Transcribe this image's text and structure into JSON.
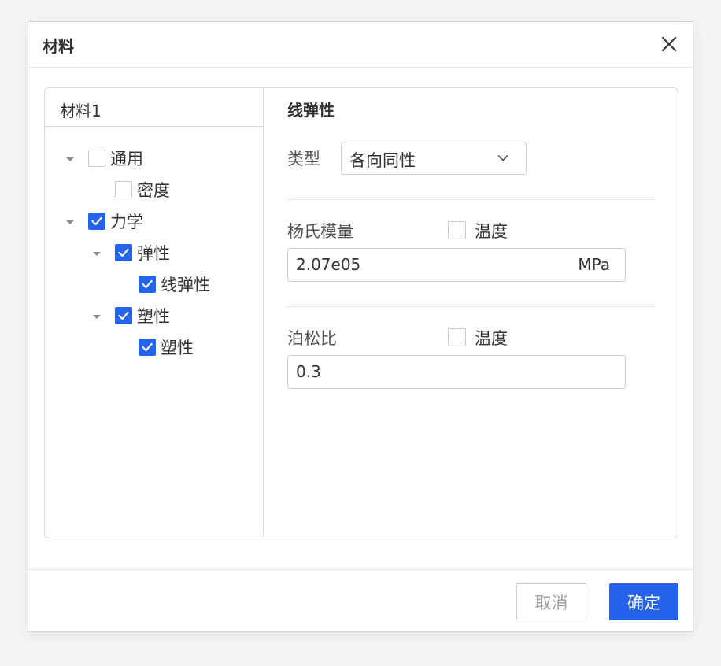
{
  "dialog": {
    "title": "材料"
  },
  "tree": {
    "header": "材料1",
    "nodes": [
      {
        "label": "通用",
        "checked": false,
        "expanded": true
      },
      {
        "label": "密度",
        "checked": false
      },
      {
        "label": "力学",
        "checked": true,
        "expanded": true
      },
      {
        "label": "弹性",
        "checked": true,
        "expanded": true
      },
      {
        "label": "线弹性",
        "checked": true
      },
      {
        "label": "塑性",
        "checked": true,
        "expanded": true
      },
      {
        "label": "塑性",
        "checked": true
      }
    ]
  },
  "detail": {
    "section_title": "线弹性",
    "type": {
      "label": "类型",
      "value": "各向同性"
    },
    "youngs": {
      "label": "杨氏模量",
      "temp_label": "温度",
      "value": "2.07e05",
      "unit": "MPa"
    },
    "poisson": {
      "label": "泊松比",
      "temp_label": "温度",
      "value": "0.3"
    }
  },
  "footer": {
    "cancel_label": "取消",
    "ok_label": "确定"
  },
  "colors": {
    "accent": "#2563eb",
    "border": "#d9d9d9",
    "text": "#333333"
  },
  "icons": [
    "close-icon",
    "caret-down-icon",
    "check-icon",
    "chevron-down-icon"
  ]
}
